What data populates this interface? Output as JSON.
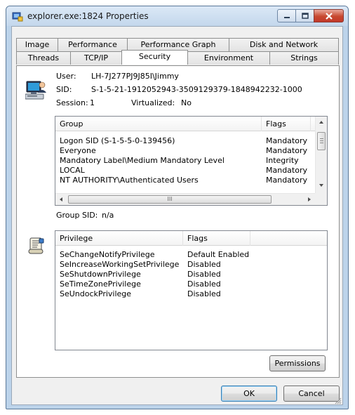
{
  "window": {
    "title": "explorer.exe:1824 Properties"
  },
  "tabs": {
    "row_top": [
      "Image",
      "Performance",
      "Performance Graph",
      "Disk and Network"
    ],
    "row_bottom": [
      "Threads",
      "TCP/IP",
      "Security",
      "Environment",
      "Strings"
    ],
    "active": "Security"
  },
  "user_info": {
    "user_label": "User:",
    "user_value": "LH-7J277PJ9J85I\\Jimmy",
    "sid_label": "SID:",
    "sid_value": "S-1-5-21-1912052943-3509129379-1848942232-1000",
    "session_label": "Session:",
    "session_value": "1",
    "virtualized_label": "Virtualized:",
    "virtualized_value": "No"
  },
  "groups_table": {
    "headers": {
      "group": "Group",
      "flags": "Flags"
    },
    "rows": [
      {
        "group": "Logon SID (S-1-5-5-0-139456)",
        "flags": "Mandatory"
      },
      {
        "group": "Everyone",
        "flags": "Mandatory"
      },
      {
        "group": "Mandatory Label\\Medium Mandatory Level",
        "flags": "Integrity"
      },
      {
        "group": "LOCAL",
        "flags": "Mandatory"
      },
      {
        "group": "NT AUTHORITY\\Authenticated Users",
        "flags": "Mandatory"
      }
    ],
    "hscroll_thumb": "III"
  },
  "group_sid": {
    "label": "Group SID:",
    "value": "n/a"
  },
  "privileges_table": {
    "headers": {
      "privilege": "Privilege",
      "flags": "Flags"
    },
    "rows": [
      {
        "privilege": "SeChangeNotifyPrivilege",
        "flags": "Default Enabled"
      },
      {
        "privilege": "SeIncreaseWorkingSetPrivilege",
        "flags": "Disabled"
      },
      {
        "privilege": "SeShutdownPrivilege",
        "flags": "Disabled"
      },
      {
        "privilege": "SeTimeZonePrivilege",
        "flags": "Disabled"
      },
      {
        "privilege": "SeUndockPrivilege",
        "flags": "Disabled"
      }
    ]
  },
  "buttons": {
    "permissions": "Permissions",
    "ok": "OK",
    "cancel": "Cancel"
  },
  "icons": {
    "app": "process-explorer-icon",
    "user": "user-computer-icon",
    "privileges": "privileges-scroll-icon"
  },
  "colors": {
    "close_button": "#c7482f",
    "titlebar": "#c3d7ec",
    "panel": "#ffffff",
    "dialog": "#f0f0f0"
  }
}
